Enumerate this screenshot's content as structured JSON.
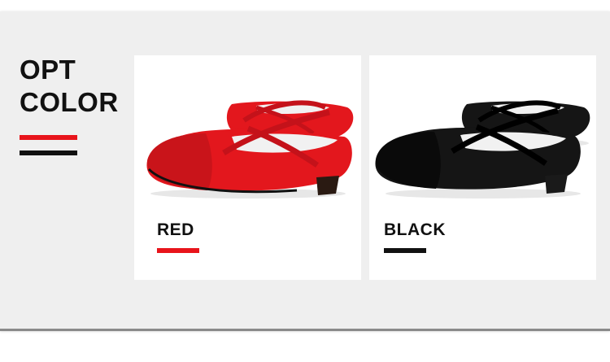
{
  "heading": {
    "line1": "OPT",
    "line2": "COLOR"
  },
  "colors": {
    "red": "#e8141b",
    "black": "#111111",
    "band": "#efefef"
  },
  "options": [
    {
      "label": "RED",
      "shoe_color": "#e3171d",
      "toe_color": "#c9141a"
    },
    {
      "label": "BLACK",
      "shoe_color": "#151515",
      "toe_color": "#0a0a0a"
    }
  ]
}
